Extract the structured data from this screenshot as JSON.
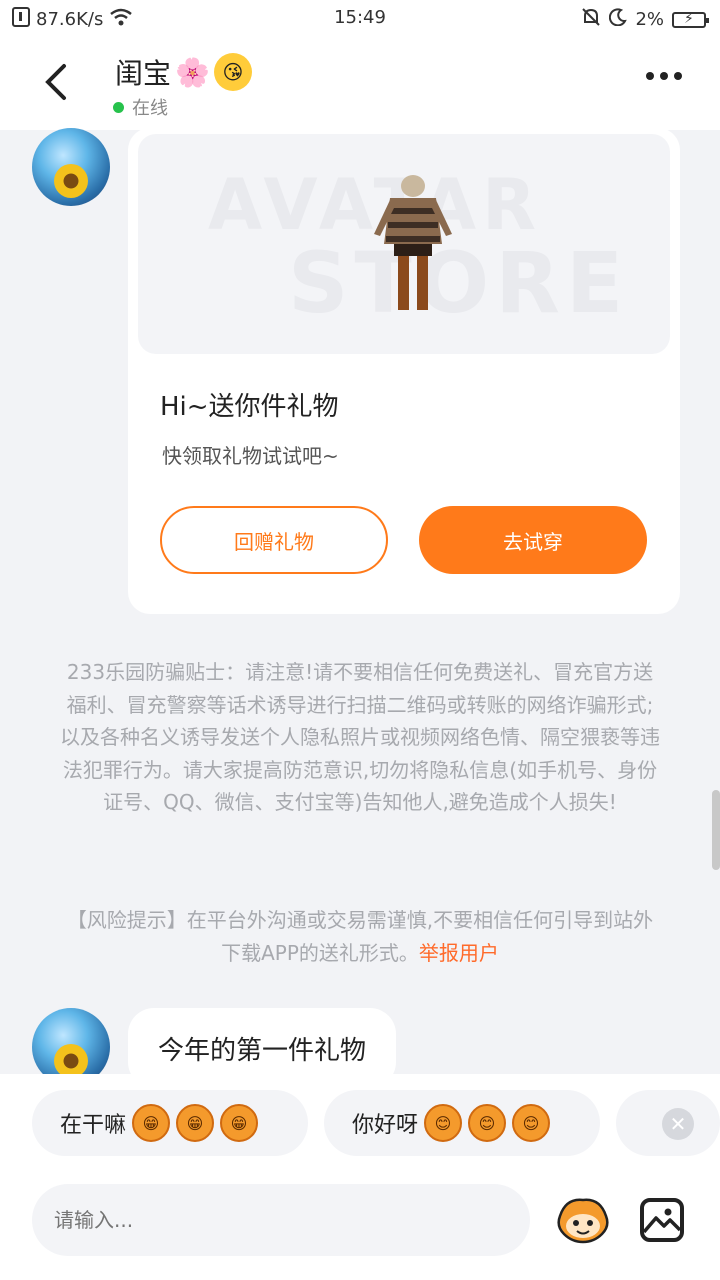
{
  "status_bar": {
    "speed": "87.6K/s",
    "time": "15:49",
    "battery": "2%"
  },
  "header": {
    "name": "闺宝",
    "status": "在线"
  },
  "gift_card": {
    "watermark_1": "AVATAR",
    "watermark_2": "STORE",
    "title": "Hi~送你件礼物",
    "subtitle": "快领取礼物试试吧~",
    "return_button": "回赠礼物",
    "try_button": "去试穿"
  },
  "notice": {
    "text": "233乐园防骗贴士：请注意!请不要相信任何免费送礼、冒充官方送福利、冒充警察等话术诱导进行扫描二维码或转账的网络诈骗形式;以及各种名义诱导发送个人隐私照片或视频网络色情、隔空猥亵等违法犯罪行为。请大家提高防范意识,切勿将隐私信息(如手机号、身份证号、QQ、微信、支付宝等)告知他人,避免造成个人损失!"
  },
  "risk": {
    "text": "【风险提示】在平台外沟通或交易需谨慎,不要相信任何引导到站外下载APP的送礼形式。",
    "link": "举报用户"
  },
  "message": {
    "text": "今年的第一件礼物"
  },
  "quick_replies": [
    {
      "label": "在干嘛"
    },
    {
      "label": "你好呀"
    }
  ],
  "input": {
    "placeholder": "请输入..."
  },
  "colors": {
    "accent": "#ff7a1a",
    "online": "#27c24c",
    "notice_text": "#a7a9ae"
  }
}
